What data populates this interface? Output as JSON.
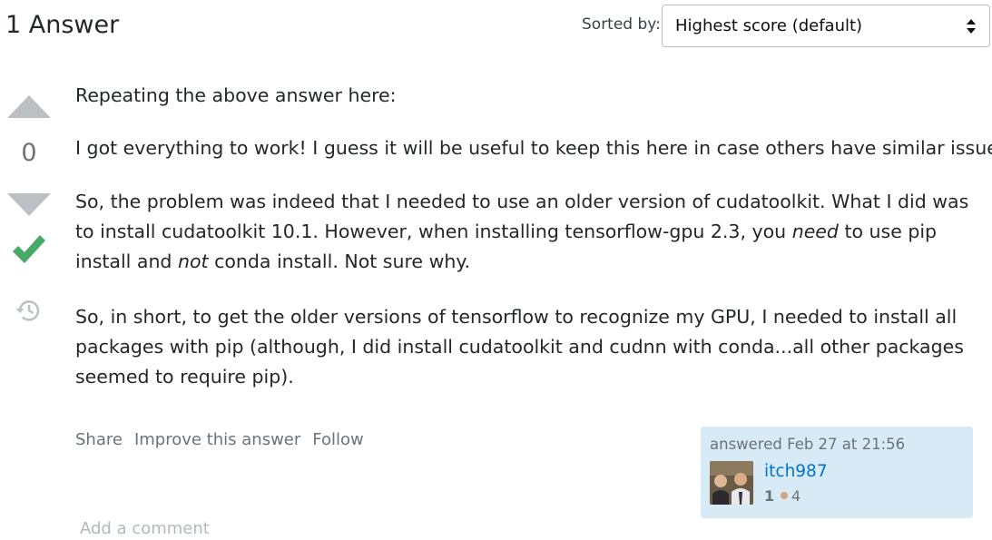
{
  "header": {
    "title": "1 Answer"
  },
  "sort": {
    "label": "Sorted by:",
    "selected": "Highest score (default)"
  },
  "votes": {
    "count": "0"
  },
  "post": {
    "p1": "Repeating the above answer here:",
    "p2": "I got everything to work! I guess it will be useful to keep this here in case others have similar issues.",
    "p3_a": "So, the problem was indeed that I needed to use an older version of cudatoolkit. What I did was to install cudatoolkit 10.1. However, when installing tensorflow-gpu 2.3, you ",
    "p3_em1": "need",
    "p3_b": " to use pip install and ",
    "p3_em2": "not",
    "p3_c": " conda install. Not sure why.",
    "p4": "So, in short, to get the older versions of tensorflow to recognize my GPU, I needed to install all packages with pip (although, I did install cudatoolkit and cudnn with conda...all other packages seemed to require pip)."
  },
  "menu": {
    "share": "Share",
    "improve": "Improve this answer",
    "follow": "Follow"
  },
  "user": {
    "action": "answered Feb 27 at 21:56",
    "name": "itch987",
    "reputation": "1",
    "bronze_badges": "4"
  },
  "comments": {
    "add": "Add a comment"
  },
  "icons": {
    "upvote": "arrow-up-icon",
    "downvote": "arrow-down-icon",
    "accepted": "checkmark-icon",
    "history": "history-icon",
    "sort": "sort-arrows-icon"
  },
  "colors": {
    "accepted": "#48a868",
    "link": "#0074cc",
    "vote_arrow": "#bbc0c4",
    "user_card_bg": "#d9eaf7",
    "bronze": "#d1a684"
  }
}
